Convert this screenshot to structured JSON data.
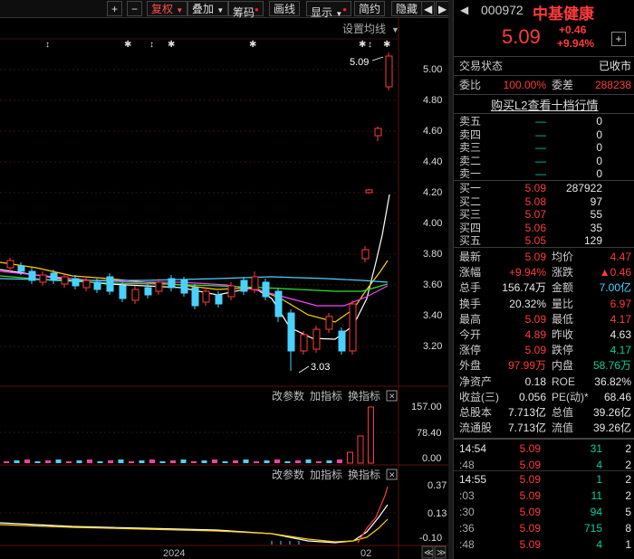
{
  "toolbar": {
    "plus": "+",
    "minus": "−",
    "fuquan": "复权",
    "diejia": "叠加",
    "chouma": "筹码",
    "huaxian": "画线",
    "xianshi": "显示",
    "jianyue": "简约",
    "yincang": "隐藏",
    "nav_left": "◀",
    "nav_right": "▶"
  },
  "chart": {
    "settings_label": "设置均线",
    "price_axis": [
      "5.00",
      "4.80",
      "4.60",
      "4.40",
      "4.20",
      "4.00",
      "3.80",
      "3.60",
      "3.40",
      "3.20"
    ],
    "high_label": "5.09",
    "low_label": "3.03",
    "sub1_buttons": [
      "改参数",
      "加指标",
      "换指标"
    ],
    "sub1_axis": [
      "157.00",
      "78.40",
      "0.00"
    ],
    "sub2_buttons": [
      "改参数",
      "加指标",
      "换指标"
    ],
    "sub2_axis": [
      "0.37",
      "0.13",
      "-0.10"
    ],
    "x_labels": [
      "2024",
      "02"
    ],
    "close_x": "✕"
  },
  "header": {
    "code": "000972",
    "name": "中基健康",
    "price": "5.09",
    "change": "+0.46",
    "pct": "+9.94%",
    "add": "+",
    "back": "◀"
  },
  "status": {
    "label": "交易状态",
    "value": "已收市"
  },
  "weibi": {
    "label": "委比",
    "value": "100.00%",
    "cha_label": "委差",
    "cha_value": "288238"
  },
  "link": "购买L2查看十档行情",
  "asks": [
    {
      "label": "卖五",
      "price": "—",
      "vol": "0"
    },
    {
      "label": "卖四",
      "price": "—",
      "vol": "0"
    },
    {
      "label": "卖三",
      "price": "—",
      "vol": "0"
    },
    {
      "label": "卖二",
      "price": "—",
      "vol": "0"
    },
    {
      "label": "卖一",
      "price": "—",
      "vol": "0"
    }
  ],
  "bids": [
    {
      "label": "买一",
      "price": "5.09",
      "vol": "287922"
    },
    {
      "label": "买二",
      "price": "5.08",
      "vol": "97"
    },
    {
      "label": "买三",
      "price": "5.07",
      "vol": "55"
    },
    {
      "label": "买四",
      "price": "5.06",
      "vol": "35"
    },
    {
      "label": "买五",
      "price": "5.05",
      "vol": "129"
    }
  ],
  "stats": [
    {
      "l1": "最新",
      "v1": "5.09",
      "c1": "red",
      "l2": "均价",
      "v2": "4.47",
      "c2": "red"
    },
    {
      "l1": "涨幅",
      "v1": "+9.94%",
      "c1": "red",
      "l2": "涨跌",
      "v2": "▲0.46",
      "c2": "red"
    },
    {
      "l1": "总手",
      "v1": "156.74万",
      "c1": "wht",
      "l2": "金额",
      "v2": "7.00亿",
      "c2": "cyan"
    },
    {
      "l1": "换手",
      "v1": "20.32%",
      "c1": "wht",
      "l2": "量比",
      "v2": "6.97",
      "c2": "red"
    },
    {
      "l1": "最高",
      "v1": "5.09",
      "c1": "red",
      "l2": "最低",
      "v2": "4.17",
      "c2": "red"
    },
    {
      "l1": "今开",
      "v1": "4.89",
      "c1": "red",
      "l2": "昨收",
      "v2": "4.63",
      "c2": "wht"
    },
    {
      "l1": "涨停",
      "v1": "5.09",
      "c1": "red",
      "l2": "跌停",
      "v2": "4.17",
      "c2": "grn"
    },
    {
      "l1": "外盘",
      "v1": "97.99万",
      "c1": "red",
      "l2": "内盘",
      "v2": "58.76万",
      "c2": "grn"
    },
    {
      "l1": "净资产",
      "v1": "0.18",
      "c1": "wht",
      "l2": "ROE",
      "v2": "36.82%",
      "c2": "wht"
    },
    {
      "l1": "收益(三)",
      "v1": "0.056",
      "c1": "wht",
      "l2": "PE(动)*",
      "v2": "68.46",
      "c2": "wht"
    },
    {
      "l1": "总股本",
      "v1": "7.713亿",
      "c1": "wht",
      "l2": "总值",
      "v2": "39.26亿",
      "c2": "wht"
    },
    {
      "l1": "流通股",
      "v1": "7.713亿",
      "c1": "wht",
      "l2": "流值",
      "v2": "39.26亿",
      "c2": "wht"
    }
  ],
  "ticks": [
    {
      "time": "14:54",
      "price": "5.09",
      "vol": "31",
      "n": "2",
      "vc": "grn"
    },
    {
      "time": ":48",
      "price": "5.09",
      "vol": "4",
      "n": "2",
      "vc": "grn"
    },
    {
      "time": "14:55",
      "price": "5.09",
      "vol": "1",
      "n": "2",
      "vc": "grn"
    },
    {
      "time": ":03",
      "price": "5.09",
      "vol": "11",
      "n": "2",
      "vc": "grn"
    },
    {
      "time": ":30",
      "price": "5.09",
      "vol": "94",
      "n": "5",
      "vc": "grn"
    },
    {
      "time": ":36",
      "price": "5.09",
      "vol": "715",
      "n": "8",
      "vc": "grn"
    },
    {
      "time": ":48",
      "price": "5.09",
      "vol": "4",
      "n": "1",
      "vc": "grn"
    }
  ]
}
